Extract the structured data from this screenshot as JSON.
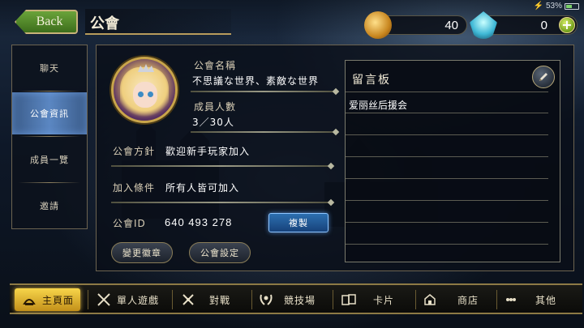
{
  "topbar": {
    "back_label": "Back",
    "title": "公會",
    "coins": "40",
    "gems": "0",
    "add_label": "+",
    "battery_percent": "53%",
    "battery_level": 0.53
  },
  "sidebar": {
    "items": [
      {
        "label": "聊天"
      },
      {
        "label": "公會資訊"
      },
      {
        "label": "成員一覽"
      },
      {
        "label": "邀請"
      }
    ]
  },
  "guild": {
    "name_label": "公會名稱",
    "name_value": "不思議な世界、素敵な世界",
    "members_label": "成員人數",
    "members_value": "3／30人",
    "policy_label": "公會方針",
    "policy_value": "歡迎新手玩家加入",
    "join_label": "加入條件",
    "join_value": "所有人皆可加入",
    "id_label": "公會ID",
    "id_value": "640 493 278",
    "copy_label": "複製",
    "change_emblem_label": "變更徽章",
    "settings_label": "公會設定"
  },
  "board": {
    "title": "留言板",
    "message": "爱丽丝后援会"
  },
  "bottomnav": {
    "items": [
      {
        "label": "主頁面",
        "icon": "home-icon"
      },
      {
        "label": "單人遊戲",
        "icon": "crossed-swords-icon"
      },
      {
        "label": "對戰",
        "icon": "sword-icon"
      },
      {
        "label": "競技場",
        "icon": "laurel-icon"
      },
      {
        "label": "卡片",
        "icon": "cards-icon"
      },
      {
        "label": "商店",
        "icon": "shop-icon"
      },
      {
        "label": "其他",
        "icon": "other-icon"
      }
    ]
  },
  "colors": {
    "accent_blue": "#5b87c2",
    "gold_border": "#c9a54a",
    "active_tab": "#f7d54a"
  }
}
